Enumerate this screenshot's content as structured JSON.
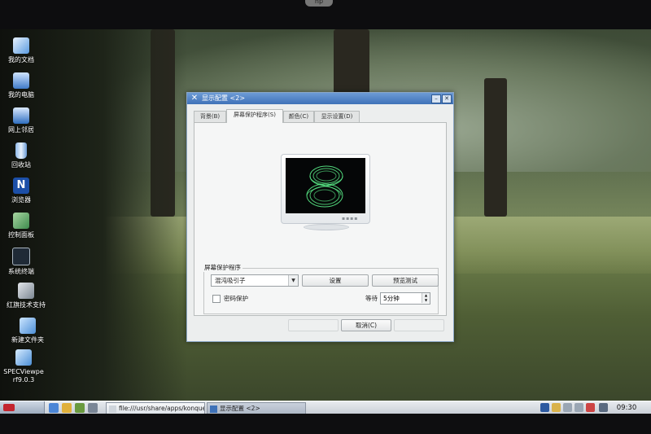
{
  "desktop": {
    "icons": [
      {
        "label": "我的文档",
        "icon": "my-documents-icon"
      },
      {
        "label": "我的电脑",
        "icon": "my-computer-icon"
      },
      {
        "label": "网上邻居",
        "icon": "network-icon"
      },
      {
        "label": "回收站",
        "icon": "recycle-bin-icon"
      },
      {
        "label": "浏览器",
        "icon": "browser-icon"
      },
      {
        "label": "控制面板",
        "icon": "control-panel-icon"
      },
      {
        "label": "系统终端",
        "icon": "terminal-icon"
      },
      {
        "label": "红旗技术支持",
        "icon": "support-icon"
      },
      {
        "label": "新建文件夹",
        "icon": "folder-icon"
      },
      {
        "label": "SPECViewpe",
        "label2": "rf9.0.3",
        "icon": "specview-icon"
      }
    ]
  },
  "dialog": {
    "title": "显示配置 <2>",
    "tabs": [
      "背景(B)",
      "屏幕保护程序(S)",
      "颜色(C)",
      "显示设置(D)"
    ],
    "active_tab": 1,
    "screensaver": {
      "group_label": "屏幕保护程序",
      "selected": "混沌吸引子",
      "settings_button": "设置",
      "preview_button": "预览测试",
      "password_label": "密码保护",
      "wait_label": "等待",
      "wait_value": "5分钟"
    },
    "footer": {
      "ok_button": "",
      "cancel_button": "取消(C)",
      "apply_button": ""
    }
  },
  "taskbar": {
    "tasks": [
      {
        "label": "file:///usr/share/apps/konqueror",
        "active": false
      },
      {
        "label": "显示配置 <2>",
        "active": true
      }
    ],
    "clock": "09:30"
  },
  "colors": {
    "titlebar": "#3f72b8",
    "accent": "#5bf08a",
    "start": "#c3252f"
  }
}
